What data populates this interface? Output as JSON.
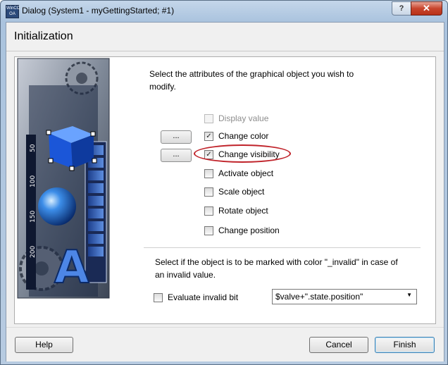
{
  "window": {
    "title": "Dialog (System1 - myGettingStarted; #1)",
    "app_icon_text": "WinCC OA",
    "help_glyph": "?",
    "close_glyph": "✕"
  },
  "page": {
    "title": "Initialization"
  },
  "attributes": {
    "instruction": "Select the attributes of the graphical object you wish to modify.",
    "options": [
      {
        "label": "Display value",
        "checked": false,
        "enabled": false
      },
      {
        "label": "Change color",
        "checked": true,
        "enabled": true
      },
      {
        "label": "Change visibility",
        "checked": true,
        "enabled": true,
        "highlighted": true
      },
      {
        "label": "Activate object",
        "checked": false,
        "enabled": true
      },
      {
        "label": "Scale object",
        "checked": false,
        "enabled": true
      },
      {
        "label": "Rotate object",
        "checked": false,
        "enabled": true
      },
      {
        "label": "Change position",
        "checked": false,
        "enabled": true
      }
    ],
    "dots_label": "...",
    "check_glyph": "✓"
  },
  "invalid": {
    "text": "Select if the object is to be marked with color \"_invalid\" in case of an invalid value.",
    "checkbox_label": "Evaluate invalid bit",
    "checkbox_checked": false,
    "dropdown_value": "$valve+\".state.position\""
  },
  "footer": {
    "help": "Help",
    "cancel": "Cancel",
    "finish": "Finish"
  },
  "illustration": {
    "scale_labels": [
      "50",
      "100",
      "150",
      "200"
    ],
    "letter": "A",
    "icons": [
      "gear-icon",
      "cube-icon",
      "sphere-icon",
      "ruler-icon"
    ]
  },
  "colors": {
    "highlight_circle": "#c0232a",
    "title_bar": "#b7cbe1",
    "close_button": "#c8452d"
  }
}
